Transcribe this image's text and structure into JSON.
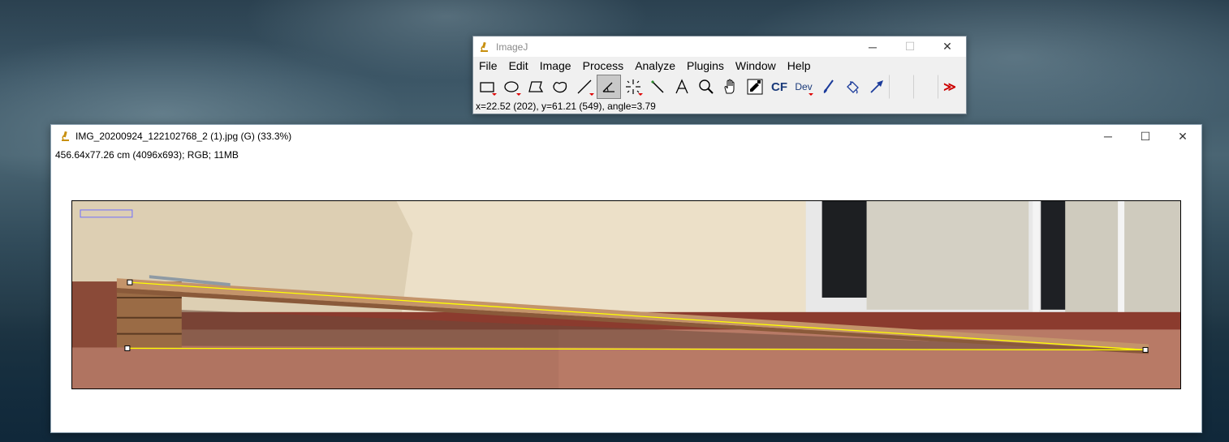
{
  "toolbar_window": {
    "title": "ImageJ",
    "menu": [
      "File",
      "Edit",
      "Image",
      "Process",
      "Analyze",
      "Plugins",
      "Window",
      "Help"
    ],
    "tools": [
      {
        "icon": "rectangle-tool-icon",
        "selected": false
      },
      {
        "icon": "oval-tool-icon",
        "selected": false
      },
      {
        "icon": "polygon-tool-icon",
        "selected": false
      },
      {
        "icon": "freehand-tool-icon",
        "selected": false
      },
      {
        "icon": "line-tool-icon",
        "selected": false
      },
      {
        "icon": "angle-tool-icon",
        "selected": true
      },
      {
        "icon": "point-tool-icon",
        "selected": false
      },
      {
        "icon": "wand-tool-icon",
        "selected": false
      },
      {
        "icon": "text-tool-icon",
        "selected": false
      },
      {
        "icon": "magnifier-tool-icon",
        "selected": false
      },
      {
        "icon": "hand-tool-icon",
        "selected": false
      },
      {
        "icon": "dropper-tool-icon",
        "selected": false
      },
      {
        "icon": "cf-tool",
        "label": "CF"
      },
      {
        "icon": "dev-tool",
        "label": "Dev"
      },
      {
        "icon": "brush-tool-icon"
      },
      {
        "icon": "flood-fill-tool-icon"
      },
      {
        "icon": "arrow-tool-icon"
      },
      {
        "icon": "empty-slot"
      },
      {
        "icon": "empty-slot"
      },
      {
        "icon": "more-tools-icon",
        "label": "≫"
      }
    ],
    "status": "x=22.52 (202), y=61.21 (549), angle=3.79"
  },
  "image_window": {
    "title": "IMG_20200924_122102768_2 (1).jpg (G) (33.3%)",
    "info": "456.64x77.26 cm (4096x693); RGB; 11MB"
  },
  "colors": {
    "selection": "#ffff00",
    "overlay": "#6f6fff",
    "wall": "#ece0c8",
    "floor": "#b87a66",
    "ramp": "#c4946a"
  }
}
